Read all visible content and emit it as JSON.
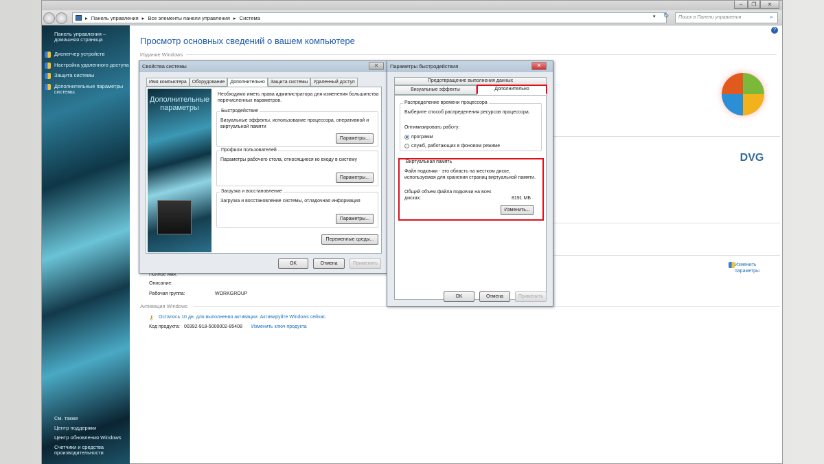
{
  "window": {
    "minimize": "–",
    "maximize": "❐",
    "close": "✕"
  },
  "address": {
    "crumbs": [
      "Панель управления",
      "Все элементы панели управления",
      "Система"
    ],
    "search_placeholder": "Поиск в Панели управления"
  },
  "sidebar": {
    "home": "Панель управления – домашняя страница",
    "items": [
      "Диспетчер устройств",
      "Настройка удаленного доступа",
      "Защита системы",
      "Дополнительные параметры системы"
    ],
    "see_also": "См. также",
    "bottom": [
      "Центр поддержки",
      "Центр обновления Windows",
      "Счетчики и средства производительности"
    ]
  },
  "main": {
    "title": "Просмотр основных сведений о вашем компьютере",
    "edition_section": "Издание Windows",
    "full_name_label": "Полное имя:",
    "description_label": "Описание:",
    "workgroup_label": "Рабочая группа:",
    "workgroup_value": "WORKGROUP",
    "activation_section": "Активация Windows",
    "activation_text": "Осталось 10 дн. для выполнения активации. Активируйте Windows сейчас",
    "product_key_label": "Код продукта:",
    "product_key": "00392-918-5000002-85408",
    "change_key": "Изменить ключ продукта",
    "change_params": "Изменить параметры",
    "logo_text": "DVG"
  },
  "sysprops": {
    "title": "Свойства системы",
    "tabs": [
      "Имя компьютера",
      "Оборудование",
      "Дополнительно",
      "Защита системы",
      "Удаленный доступ"
    ],
    "banner": "Дополнительные параметры",
    "admin_note": "Необходимо иметь права администратора для изменения большинства перечисленных параметров.",
    "groups": [
      {
        "title": "Быстродействие",
        "text": "Визуальные эффекты, использование процессора, оперативной и виртуальной памяти",
        "button": "Параметры..."
      },
      {
        "title": "Профили пользователей",
        "text": "Параметры рабочего стола, относящиеся ко входу в систему",
        "button": "Параметры..."
      },
      {
        "title": "Загрузка и восстановление",
        "text": "Загрузка и восстановление системы, отладочная информация",
        "button": "Параметры..."
      }
    ],
    "env_button": "Переменные среды...",
    "ok": "OK",
    "cancel": "Отмена",
    "apply": "Применить"
  },
  "perf": {
    "title": "Параметры быстродействия",
    "tabs_top": "Предотвращение выполнения данных",
    "tab_visual": "Визуальные эффекты",
    "tab_advanced": "Дополнительно",
    "cpu_group": "Распределение времени процессора",
    "cpu_text": "Выберите способ распределения ресурсов процессора.",
    "optimize_label": "Оптимизировать работу:",
    "radio_programs": "программ",
    "radio_services": "служб, работающих в фоновом режиме",
    "vm_group": "Виртуальная память",
    "vm_text": "Файл подкачки - это область на жестком диске, используемая для хранения страниц виртуальной памяти.",
    "vm_total_label": "Общий объем файла подкачки на всех дисках:",
    "vm_total_value": "8191 МБ",
    "change_button": "Изменить...",
    "ok": "OK",
    "cancel": "Отмена",
    "apply": "Применить"
  },
  "colors": {
    "highlight": "#e0101a",
    "link": "#1e6fb8"
  }
}
